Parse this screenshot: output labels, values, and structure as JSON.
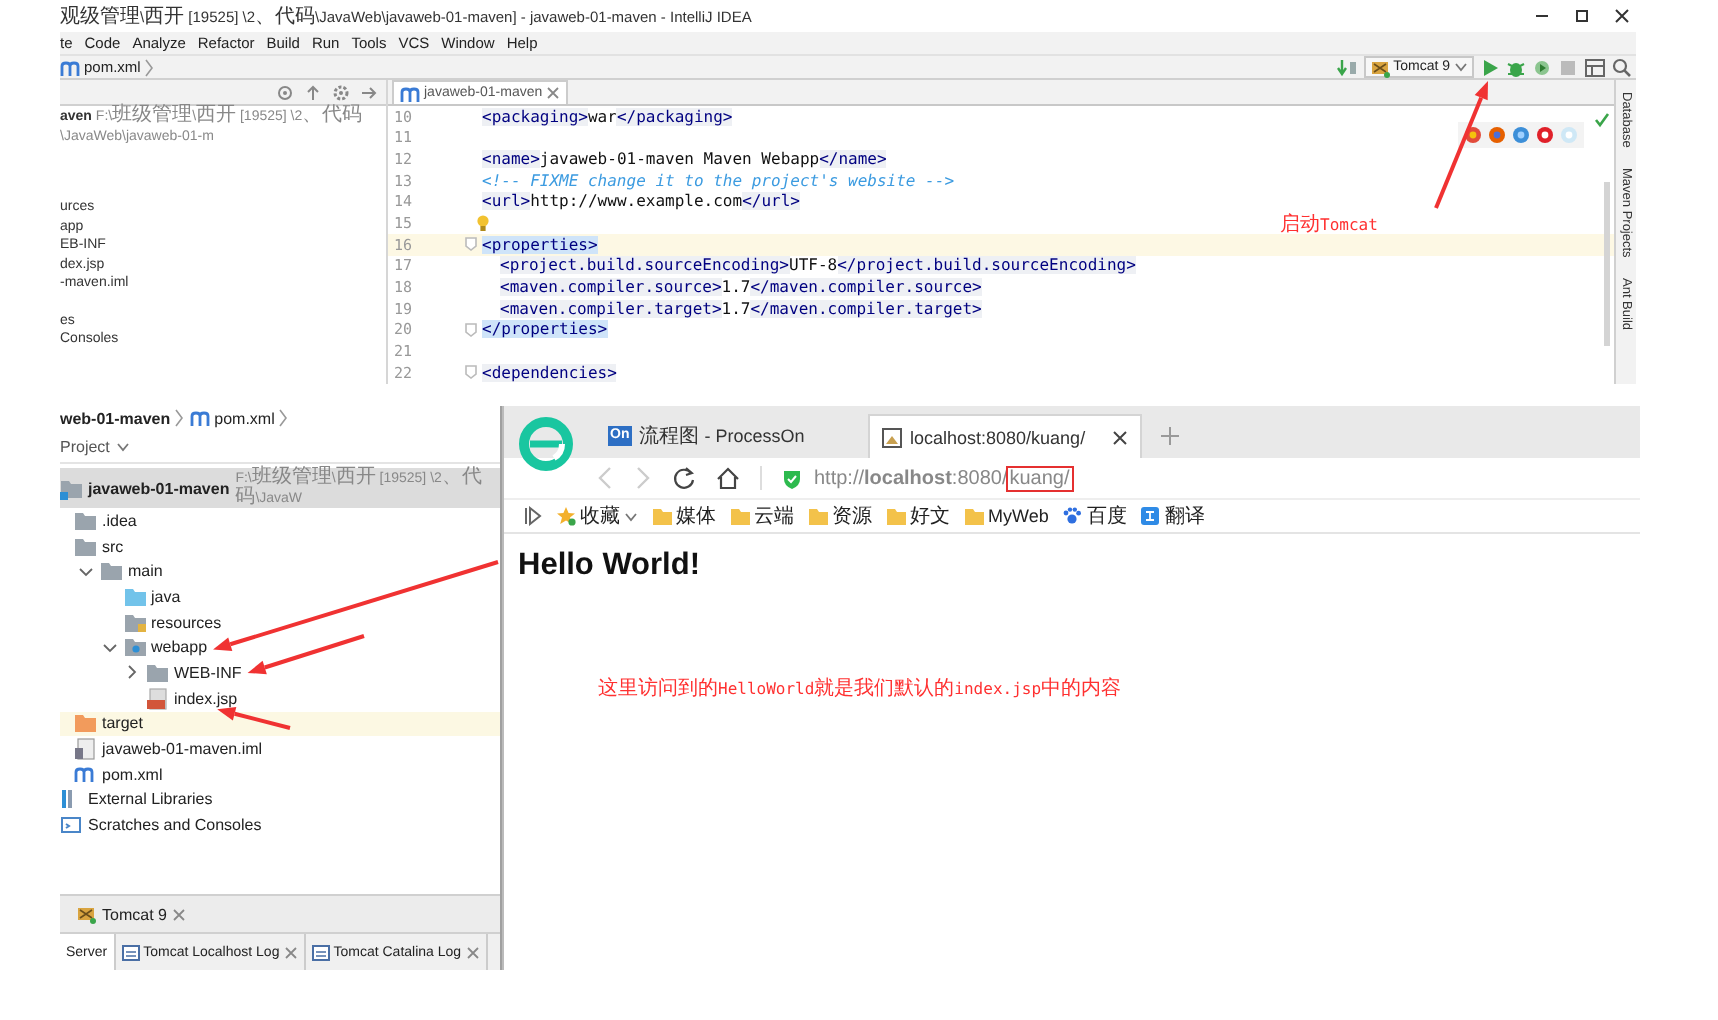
{
  "ide": {
    "title": "观级管理\\西开 [19525] \\2、代码\\JavaWeb\\javaweb-01-maven] - javaweb-01-maven - IntelliJ IDEA",
    "menu": [
      "te",
      "Code",
      "Analyze",
      "Refactor",
      "Build",
      "Run",
      "Tools",
      "VCS",
      "Window",
      "Help"
    ],
    "breadcrumb": "pom.xml",
    "run_config": "Tomcat 9",
    "project_fragments": [
      {
        "name": "aven",
        "path": "F:\\班级管理\\西开 [19525] \\2、代码\\JavaWeb\\javaweb-01-m"
      },
      {
        "name": "urces"
      },
      {
        "name": "app"
      },
      {
        "name": "EB-INF"
      },
      {
        "name": "dex.jsp"
      },
      {
        "name": "-maven.iml"
      },
      {
        "name": "es"
      },
      {
        "name": "Consoles"
      }
    ],
    "editor_tab": {
      "label": "javaweb-01-maven",
      "selected": true
    },
    "lines": [
      {
        "number": "10",
        "kind": "plain",
        "current": false,
        "indented": false,
        "segments": [
          {
            "kind": "tag",
            "text": "<packaging>"
          },
          {
            "kind": "text",
            "text": "war"
          },
          {
            "kind": "tag",
            "text": "</packaging>"
          }
        ]
      },
      {
        "number": "11",
        "kind": "plain"
      },
      {
        "number": "12",
        "kind": "plain",
        "current": false,
        "indented": false,
        "segments": [
          {
            "kind": "tag",
            "text": "<name>"
          },
          {
            "kind": "text",
            "text": "javaweb-01-maven Maven Webapp"
          },
          {
            "kind": "tag",
            "text": "</name>"
          }
        ]
      },
      {
        "number": "13",
        "kind": "plain",
        "current": false,
        "indented": false,
        "segments": [
          {
            "kind": "comment",
            "text": "<!-- FIXME change it to the project's website -->"
          }
        ]
      },
      {
        "number": "14",
        "kind": "plain",
        "current": false,
        "indented": false,
        "segments": [
          {
            "kind": "tag",
            "text": "<url>"
          },
          {
            "kind": "text",
            "text": "http://www.example.com"
          },
          {
            "kind": "tag",
            "text": "</url>"
          }
        ]
      },
      {
        "number": "15",
        "kind": "bulb"
      },
      {
        "number": "16",
        "kind": "fold",
        "current": true,
        "indented": false,
        "segments": [
          {
            "kind": "tag-match",
            "text": "<properties>"
          }
        ]
      },
      {
        "number": "17",
        "kind": "plain",
        "current": false,
        "indented": true,
        "segments": [
          {
            "kind": "tag",
            "text": "<project.build.sourceEncoding>"
          },
          {
            "kind": "text",
            "text": "UTF-8"
          },
          {
            "kind": "tag",
            "text": "</project.build.sourceEncoding>"
          }
        ]
      },
      {
        "number": "18",
        "kind": "plain",
        "current": false,
        "indented": true,
        "segments": [
          {
            "kind": "tag",
            "text": "<maven.compiler.source>"
          },
          {
            "kind": "text",
            "text": "1.7"
          },
          {
            "kind": "tag",
            "text": "</maven.compiler.source>"
          }
        ]
      },
      {
        "number": "19",
        "kind": "plain",
        "current": false,
        "indented": true,
        "segments": [
          {
            "kind": "tag",
            "text": "<maven.compiler.target>"
          },
          {
            "kind": "text",
            "text": "1.7"
          },
          {
            "kind": "tag",
            "text": "</maven.compiler.target>"
          }
        ]
      },
      {
        "number": "20",
        "kind": "fold",
        "current": false,
        "indented": false,
        "segments": [
          {
            "kind": "tag-match",
            "text": "</properties>"
          }
        ]
      },
      {
        "number": "21",
        "kind": "plain"
      },
      {
        "number": "22",
        "kind": "fold",
        "current": false,
        "indented": false,
        "segments": [
          {
            "kind": "tag",
            "text": "<dependencies>"
          }
        ]
      }
    ],
    "side_tabs": [
      "Database",
      "Maven Projects",
      "Ant Build"
    ]
  },
  "project": {
    "breadcrumb": [
      "web-01-maven",
      "pom.xml"
    ],
    "header": "Project",
    "tree": [
      {
        "label": "javaweb-01-maven",
        "path": "F:\\班级管理\\西开 [19525] \\2、代码\\JavaW",
        "kind": "module",
        "selected": true,
        "highlighted": false,
        "children": [
          {
            "label": ".idea",
            "kind": "folder",
            "selected": false,
            "highlighted": false
          },
          {
            "label": "src",
            "kind": "folder",
            "selected": false,
            "highlighted": false,
            "children": [
              {
                "label": "main",
                "kind": "folder",
                "expanded": true,
                "selected": false,
                "highlighted": false,
                "children": [
                  {
                    "label": "java",
                    "kind": "source-folder",
                    "selected": false,
                    "highlighted": false
                  },
                  {
                    "label": "resources",
                    "kind": "resources-folder",
                    "selected": false,
                    "highlighted": false
                  },
                  {
                    "label": "webapp",
                    "kind": "web-folder",
                    "expanded": true,
                    "selected": false,
                    "highlighted": false,
                    "children": [
                      {
                        "label": "WEB-INF",
                        "kind": "folder",
                        "expanded": false,
                        "selected": false,
                        "highlighted": false
                      },
                      {
                        "label": "index.jsp",
                        "kind": "jsp",
                        "selected": false,
                        "highlighted": false
                      }
                    ]
                  }
                ]
              }
            ]
          },
          {
            "label": "target",
            "kind": "excluded-folder",
            "selected": false,
            "highlighted": true
          },
          {
            "label": "javaweb-01-maven.iml",
            "kind": "iml",
            "selected": false,
            "highlighted": false
          },
          {
            "label": "pom.xml",
            "kind": "maven",
            "selected": false,
            "highlighted": false
          }
        ]
      },
      {
        "label": "External Libraries",
        "kind": "libraries",
        "selected": false,
        "highlighted": false
      },
      {
        "label": "Scratches and Consoles",
        "kind": "scratches",
        "selected": false,
        "highlighted": false
      }
    ]
  },
  "run_panel": {
    "title": "Tomcat 9",
    "tabs": [
      {
        "label": "Server",
        "selected": true,
        "closable": false
      },
      {
        "label": "Tomcat Localhost Log",
        "selected": false,
        "closable": true
      },
      {
        "label": "Tomcat Catalina Log",
        "selected": false,
        "closable": true
      }
    ]
  },
  "browser": {
    "tabs": [
      {
        "badge": "On",
        "label": "流程图 - ProcessOn",
        "selected": false
      },
      {
        "label": "localhost:8080/kuang/",
        "selected": true
      }
    ],
    "url": "http://**localhost**:8080/",
    "url_marked": "kuang/",
    "bookmarks": [
      {
        "label": "收藏",
        "kind": "star",
        "dropdown": true
      },
      {
        "label": "媒体",
        "kind": "folder"
      },
      {
        "label": "云端",
        "kind": "folder"
      },
      {
        "label": "资源",
        "kind": "folder"
      },
      {
        "label": "好文",
        "kind": "folder"
      },
      {
        "label": "MyWeb",
        "kind": "folder"
      },
      {
        "label": "百度",
        "kind": "paw"
      },
      {
        "label": "翻译",
        "kind": "translate"
      }
    ],
    "heading": "Hello World!"
  },
  "annotations": [
    {
      "text": "启动Tomcat"
    },
    {
      "text": "这里访问到的HelloWorld就是我们默认的index.jsp中的内容"
    }
  ]
}
